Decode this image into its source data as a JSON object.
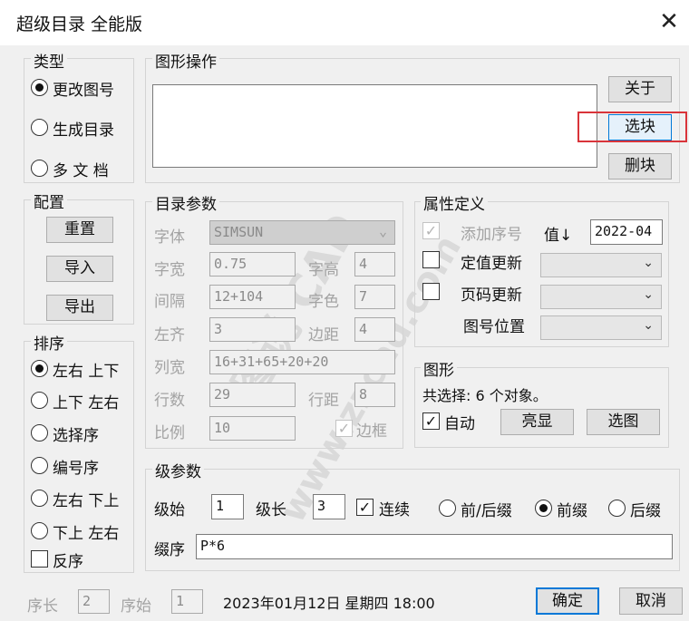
{
  "window": {
    "title": "超级目录 全能版",
    "close_icon": "close-icon"
  },
  "type_group": {
    "title": "类型",
    "options": [
      "更改图号",
      "生成目录",
      "多 文 档"
    ],
    "selected": 0
  },
  "config_group": {
    "title": "配置",
    "reset": "重置",
    "import": "导入",
    "export": "导出"
  },
  "sort_group": {
    "title": "排序",
    "options": [
      "左右 上下",
      "上下 左右",
      "选择序",
      "编号序",
      "左右 下上",
      "下上 左右"
    ],
    "selected": 0,
    "reverse_label": "反序",
    "reverse_checked": false
  },
  "graphic_ops": {
    "title": "图形操作",
    "about": "关于",
    "select_block": "选块",
    "delete_block": "删块",
    "highlight_color": "#d9343a"
  },
  "catalog_params": {
    "title": "目录参数",
    "font_label": "字体",
    "font_value": "SIMSUN",
    "width_label": "字宽",
    "width_value": "0.75",
    "height_label": "字高",
    "height_value": "4",
    "gap_label": "间隔",
    "gap_value": "12+104",
    "color_label": "字色",
    "color_value": "7",
    "leftalign_label": "左齐",
    "leftalign_value": "3",
    "margin_label": "边距",
    "margin_value": "4",
    "colwidth_label": "列宽",
    "colwidth_value": "16+31+65+20+20",
    "rows_label": "行数",
    "rows_value": "29",
    "rowspacing_label": "行距",
    "rowspacing_value": "8",
    "scale_label": "比例",
    "scale_value": "10",
    "border_label": "边框",
    "border_checked": true
  },
  "attr_def": {
    "title": "属性定义",
    "add_seq_label": "添加序号",
    "add_seq_checked": true,
    "value_label": "值↓",
    "value": "2022-04",
    "fixed_update_label": "定值更新",
    "fixed_update_checked": false,
    "page_update_label": "页码更新",
    "page_update_checked": false,
    "drawing_no_pos_label": "图号位置"
  },
  "figure": {
    "title": "图形",
    "selection_text": "共选择: 6 个对象。",
    "auto_label": "自动",
    "auto_checked": true,
    "highlight_button": "亮显",
    "select_figure_button": "选图"
  },
  "level_params": {
    "title": "级参数",
    "start_label": "级始",
    "start_value": "1",
    "length_label": "级长",
    "length_value": "3",
    "continuous_label": "连续",
    "continuous_checked": true,
    "affix_options": [
      "前/后缀",
      "前缀",
      "后缀"
    ],
    "affix_selected": 1,
    "order_label": "缀序",
    "order_value": "P*6"
  },
  "footer": {
    "seq_len_label": "序长",
    "seq_len_value": "2",
    "seq_start_label": "序始",
    "seq_start_value": "1",
    "datetime": "2023年01月12日 星期四 18:00",
    "ok": "确定",
    "cancel": "取消"
  },
  "watermark": [
    "图说 CAD",
    "www.zzcad.com"
  ]
}
